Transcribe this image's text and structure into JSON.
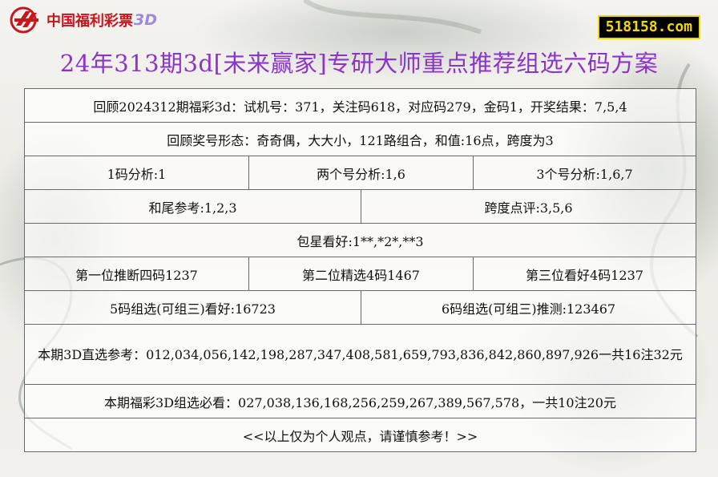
{
  "brand": {
    "name": "中国福利彩票",
    "suffix": "3D",
    "logo": "cwl-logo-icon"
  },
  "site_badge": "518158.com",
  "title": "24年313期3d[未来赢家]专研大师重点推荐组选六码方案",
  "rows": {
    "review": "回顾2024312期福彩3d：试机号：371，关注码618，对应码279，金码1，开奖结果：7,5,4",
    "form": "回顾奖号形态：奇奇偶，大大小，121路组合，和值:16点，跨度为3",
    "one_code": "1码分析:1",
    "two_code": "两个号分析:1,6",
    "three_code": "3个号分析:1,6,7",
    "sum_tail": "和尾参考:1,2,3",
    "span": "跨度点评:3,5,6",
    "baoxing": "包星看好:1**,*2*,**3",
    "pos1": "第一位推断四码1237",
    "pos2": "第二位精选4码1467",
    "pos3": "第三位看好4码1237",
    "group5": "5码组选(可组三)看好:16723",
    "group6": "6码组选(可组三)推测:123467",
    "direct_picks": "本期3D直选参考：012,034,056,142,198,287,347,408,581,659,793,836,842,860,897,926一共16注32元",
    "group_picks": "本期福彩3D组选必看：027,038,136,168,256,259,267,389,567,578，一共10注20元",
    "disclaimer": "<<以上仅为个人观点，请谨慎参考！>>"
  },
  "colors": {
    "title": "#8a35c8",
    "brand_red": "#c8161d",
    "badge_bg": "#000000",
    "badge_text": "#f2d900"
  }
}
